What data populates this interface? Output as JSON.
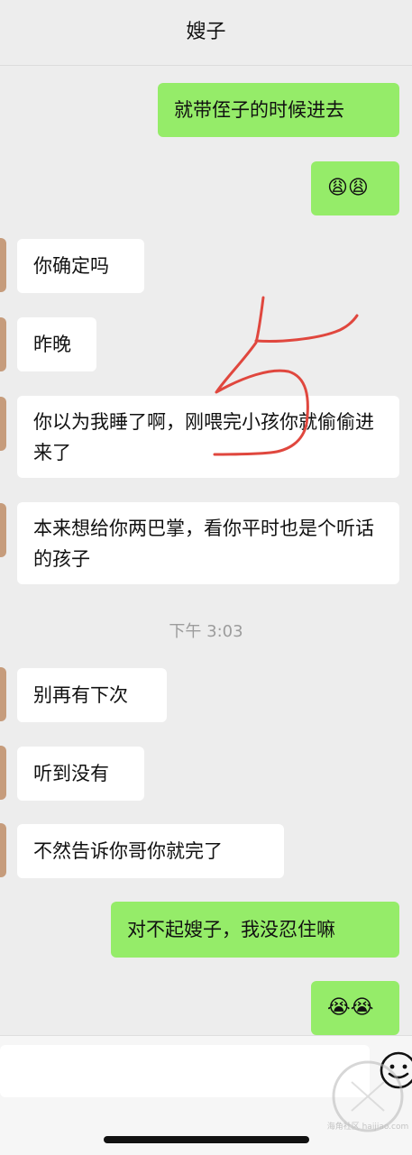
{
  "header": {
    "title": "嫂子"
  },
  "messages": [
    {
      "side": "out",
      "text": "就带侄子的时候进去"
    },
    {
      "side": "out",
      "text": "😩😩"
    },
    {
      "side": "in",
      "text": "你确定吗"
    },
    {
      "side": "in",
      "text": "昨晚"
    },
    {
      "side": "in",
      "text": "你以为我睡了啊，刚喂完小孩你就偷偷进来了"
    },
    {
      "side": "in",
      "text": "本来想给你两巴掌，看你平时也是个听话的孩子"
    },
    {
      "side": "in",
      "text": "别再有下次"
    },
    {
      "side": "in",
      "text": "听到没有"
    },
    {
      "side": "in",
      "text": "不然告诉你哥你就完了"
    },
    {
      "side": "out",
      "text": "对不起嫂子，我没忍住嘛"
    },
    {
      "side": "out",
      "text": "😭😭"
    }
  ],
  "timestamp": "下午 3:03",
  "annotation": {
    "text": "5",
    "color": "#e0473e"
  },
  "watermark": {
    "text": "海角社区 haijiao.com"
  },
  "colors": {
    "out_bubble": "#95ec69",
    "in_bubble": "#ffffff",
    "background": "#ededed"
  }
}
